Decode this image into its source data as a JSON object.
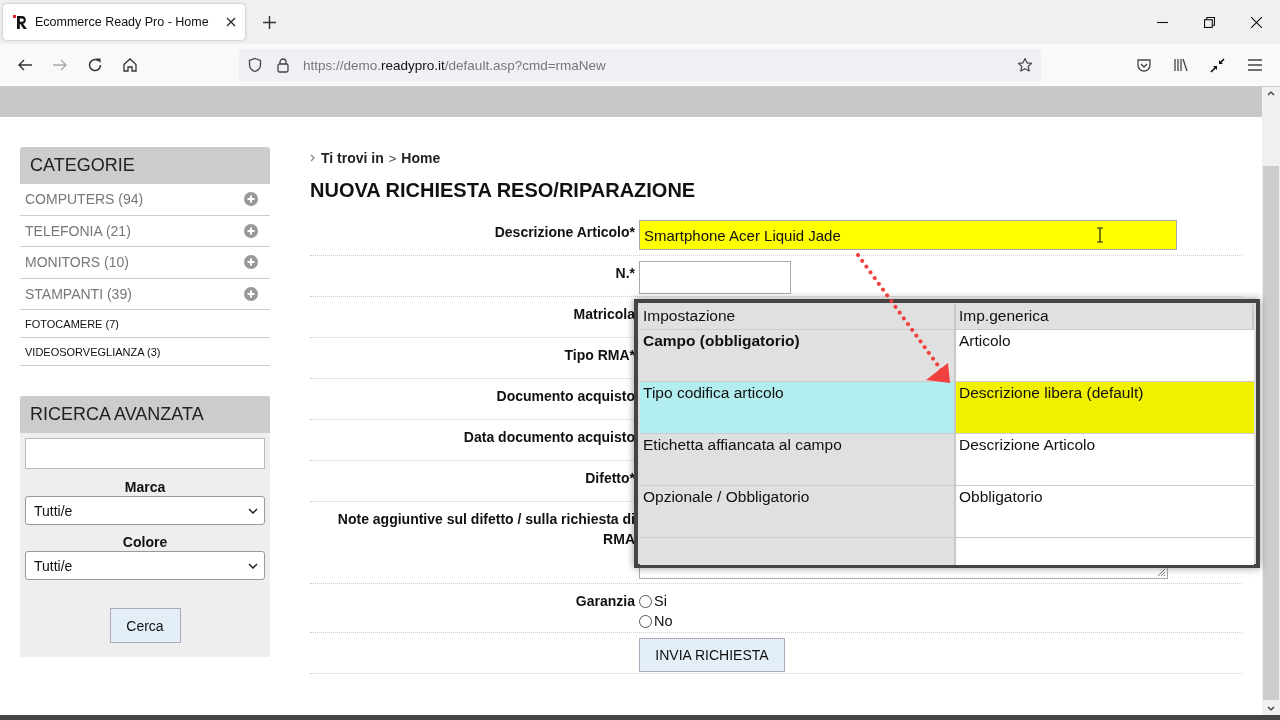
{
  "browser": {
    "tab_title": "Ecommerce Ready Pro - Home",
    "url": {
      "scheme_host": "https://demo.",
      "domain": "readypro.it",
      "path": "/default.asp?cmd=rmaNew"
    }
  },
  "sidebar": {
    "title": "CATEGORIE",
    "items": [
      {
        "label": "COMPUTERS (94)",
        "expandable": true
      },
      {
        "label": "TELEFONIA (21)",
        "expandable": true
      },
      {
        "label": "MONITORS (10)",
        "expandable": true
      },
      {
        "label": "STAMPANTI (39)",
        "expandable": true
      },
      {
        "label": "FOTOCAMERE (7)",
        "expandable": false
      },
      {
        "label": "VIDEOSORVEGLIANZA (3)",
        "expandable": false
      }
    ]
  },
  "advanced_search": {
    "title": "RICERCA AVANZATA",
    "filters": [
      {
        "label": "Marca",
        "value": "Tutti/e"
      },
      {
        "label": "Colore",
        "value": "Tutti/e"
      }
    ],
    "button": "Cerca"
  },
  "breadcrumb": {
    "prefix": "Ti trovi in",
    "separator": ">",
    "current": "Home"
  },
  "heading": "NUOVA RICHIESTA RESO/RIPARAZIONE",
  "form": {
    "rows": [
      {
        "label": "Descrizione Articolo*",
        "kind": "text",
        "value": "Smartphone Acer Liquid Jade",
        "highlighted": true
      },
      {
        "label": "N.*",
        "kind": "text",
        "highlighted": false
      },
      {
        "label": "Matricola"
      },
      {
        "label": "Tipo RMA*"
      },
      {
        "label": "Documento acquisto"
      },
      {
        "label": "Data documento acquisto"
      },
      {
        "label": "Difetto*"
      },
      {
        "label": "Note aggiuntive sul difetto / sulla richiesta di RMA",
        "kind": "textarea"
      },
      {
        "label": "Garanzia",
        "kind": "radio",
        "options": [
          {
            "label": "Si",
            "selected": false
          },
          {
            "label": "No",
            "selected": false
          }
        ]
      },
      {
        "kind": "submit",
        "button": "INVIA RICHIESTA"
      }
    ]
  },
  "settings_popup": {
    "columns": [
      "Impostazione",
      "Imp.generica"
    ],
    "rows": [
      {
        "kind": "title",
        "setting": "Campo (obbligatorio)",
        "value": "Articolo"
      },
      {
        "kind": "highlighted",
        "setting": "Tipo codifica articolo",
        "value": "Descrizione libera (default)"
      },
      {
        "kind": "plain",
        "setting": "Etichetta affiancata al campo",
        "value": "Descrizione Articolo"
      },
      {
        "kind": "plain",
        "setting": "Opzionale / Obbligatorio",
        "value": "Obbligatorio"
      },
      {
        "kind": "blank"
      }
    ]
  }
}
